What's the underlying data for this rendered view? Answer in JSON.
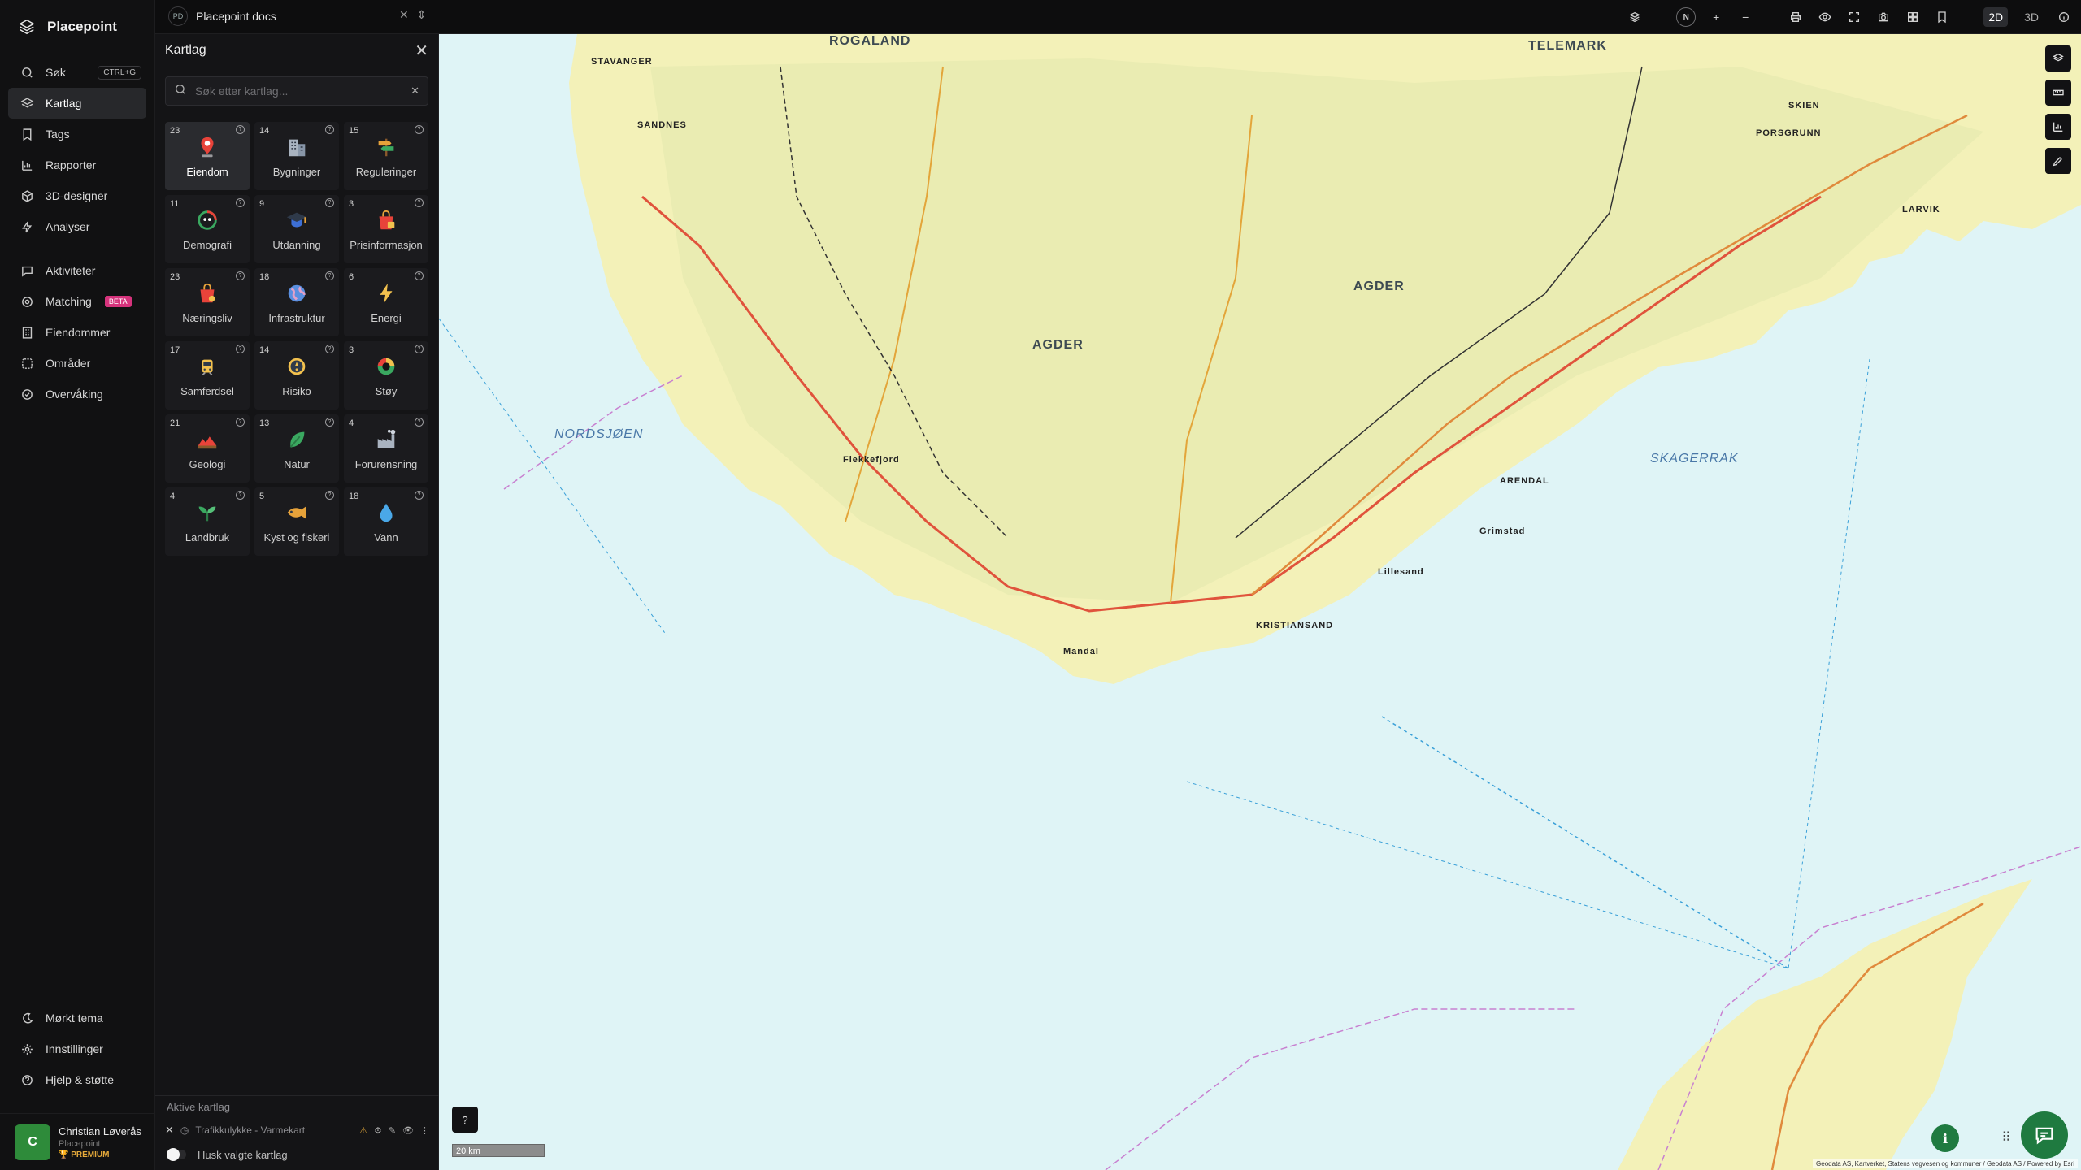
{
  "app": {
    "name": "Placepoint"
  },
  "nav": {
    "items": [
      {
        "label": "Søk",
        "shortcut": "CTRL+G",
        "icon": "search-icon"
      },
      {
        "label": "Kartlag",
        "icon": "layers-icon",
        "active": true
      },
      {
        "label": "Tags",
        "icon": "bookmark-icon"
      },
      {
        "label": "Rapporter",
        "icon": "bar-chart-icon"
      },
      {
        "label": "3D-designer",
        "icon": "cube-icon"
      },
      {
        "label": "Analyser",
        "icon": "lightning-icon"
      }
    ],
    "items2": [
      {
        "label": "Aktiviteter",
        "icon": "chat-icon"
      },
      {
        "label": "Matching",
        "badge": "BETA",
        "icon": "target-icon"
      },
      {
        "label": "Eiendommer",
        "icon": "building-icon"
      },
      {
        "label": "Områder",
        "icon": "area-icon"
      },
      {
        "label": "Overvåking",
        "icon": "check-circle-icon"
      }
    ],
    "bottom": [
      {
        "label": "Mørkt tema",
        "icon": "moon-icon"
      },
      {
        "label": "Innstillinger",
        "icon": "gear-icon"
      },
      {
        "label": "Hjelp & støtte",
        "icon": "help-icon"
      }
    ]
  },
  "user": {
    "initial": "C",
    "name": "Christian Løverås",
    "org": "Placepoint",
    "plan": "PREMIUM"
  },
  "topbar": {
    "project_badge": "PD",
    "project_name": "Placepoint docs",
    "modes": [
      "2D",
      "3D"
    ],
    "compass": "N"
  },
  "panel": {
    "title": "Kartlag",
    "search_placeholder": "Søk etter kartlag...",
    "tiles": [
      {
        "count": "23",
        "label": "Eiendom",
        "icon": "pin-icon",
        "active": true
      },
      {
        "count": "14",
        "label": "Bygninger",
        "icon": "buildings-icon"
      },
      {
        "count": "15",
        "label": "Reguleringer",
        "icon": "signpost-icon"
      },
      {
        "count": "11",
        "label": "Demografi",
        "icon": "demography-icon"
      },
      {
        "count": "9",
        "label": "Utdanning",
        "icon": "graduation-icon"
      },
      {
        "count": "3",
        "label": "Prisinformasjon",
        "icon": "price-bag-icon"
      },
      {
        "count": "23",
        "label": "Næringsliv",
        "icon": "shopping-bag-icon"
      },
      {
        "count": "18",
        "label": "Infrastruktur",
        "icon": "globe-icon"
      },
      {
        "count": "6",
        "label": "Energi",
        "icon": "bolt-icon"
      },
      {
        "count": "17",
        "label": "Samferdsel",
        "icon": "tram-icon"
      },
      {
        "count": "14",
        "label": "Risiko",
        "icon": "risk-icon"
      },
      {
        "count": "3",
        "label": "Støy",
        "icon": "noise-icon"
      },
      {
        "count": "21",
        "label": "Geologi",
        "icon": "terrain-icon"
      },
      {
        "count": "13",
        "label": "Natur",
        "icon": "leaf-icon"
      },
      {
        "count": "4",
        "label": "Forurensning",
        "icon": "factory-icon"
      },
      {
        "count": "4",
        "label": "Landbruk",
        "icon": "sprout-icon"
      },
      {
        "count": "5",
        "label": "Kyst og fiskeri",
        "icon": "fish-icon"
      },
      {
        "count": "18",
        "label": "Vann",
        "icon": "water-drop-icon"
      }
    ],
    "active_title": "Aktive kartlag",
    "active_layer": "Trafikkulykke - Varmekart",
    "remember_label": "Husk valgte kartlag"
  },
  "map": {
    "labels": {
      "stavanger": "STAVANGER",
      "rogaland": "ROGALAND",
      "telemark": "TELEMARK",
      "agder1": "AGDER",
      "agder2": "AGDER",
      "nordsjoen": "NORDSJØEN",
      "skagerrak": "SKAGERRAK",
      "kristiansand": "KRISTIANSAND",
      "arendal": "ARENDAL",
      "larvik": "LARVIK",
      "skien": "SKIEN",
      "sandnes": "SANDNES",
      "mandal": "Mandal",
      "flekkefjord": "Flekkefjord",
      "grimstad": "Grimstad",
      "lillesand": "Lillesand",
      "porsgrunn": "PORSGRUNN"
    },
    "scale": "20 km",
    "attribution": "Geodata AS, Kartverket, Statens vegvesen og kommuner / Geodata AS / Powered by Esri"
  },
  "colors": {
    "accent": "#1f7a40",
    "beta": "#d6337c",
    "premium": "#e5a93a"
  }
}
